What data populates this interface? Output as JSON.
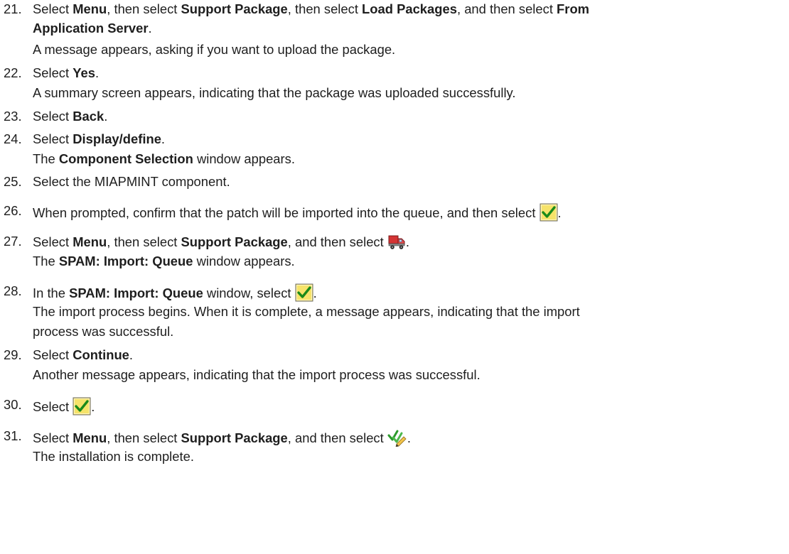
{
  "steps": [
    {
      "number": "21.",
      "lines": [
        [
          {
            "t": "Select "
          },
          {
            "t": "Menu",
            "b": true
          },
          {
            "t": ", then select "
          },
          {
            "t": "Support Package",
            "b": true
          },
          {
            "t": ", then select "
          },
          {
            "t": "Load Packages",
            "b": true
          },
          {
            "t": ", and then select "
          },
          {
            "t": "From",
            "b": true
          }
        ],
        [
          {
            "t": "Application Server",
            "b": true
          },
          {
            "t": "."
          }
        ],
        [
          {
            "t": "A message appears, asking if you want to upload the package."
          }
        ]
      ]
    },
    {
      "number": "22.",
      "lines": [
        [
          {
            "t": "Select "
          },
          {
            "t": "Yes",
            "b": true
          },
          {
            "t": "."
          }
        ],
        [
          {
            "t": "A summary screen appears, indicating that the package was uploaded successfully."
          }
        ]
      ]
    },
    {
      "number": "23.",
      "lines": [
        [
          {
            "t": "Select "
          },
          {
            "t": "Back",
            "b": true
          },
          {
            "t": "."
          }
        ]
      ]
    },
    {
      "number": "24.",
      "lines": [
        [
          {
            "t": "Select "
          },
          {
            "t": "Display/define",
            "b": true
          },
          {
            "t": "."
          }
        ],
        [
          {
            "t": "The "
          },
          {
            "t": "Component Selection",
            "b": true
          },
          {
            "t": " window appears."
          }
        ]
      ]
    },
    {
      "number": "25.",
      "lines": [
        [
          {
            "t": "Select the MIAPMINT component."
          }
        ]
      ]
    },
    {
      "number": "26.",
      "lines": [
        [
          {
            "t": "When prompted, confirm that the patch will be imported into the queue, and then select "
          },
          {
            "icon": "checkmark-icon"
          },
          {
            "t": "."
          }
        ]
      ]
    },
    {
      "number": "27.",
      "lines": [
        [
          {
            "t": "Select "
          },
          {
            "t": "Menu",
            "b": true
          },
          {
            "t": ", then select "
          },
          {
            "t": "Support Package",
            "b": true
          },
          {
            "t": ", and then select "
          },
          {
            "icon": "truck-icon"
          },
          {
            "t": "."
          }
        ],
        [
          {
            "t": "The "
          },
          {
            "t": "SPAM: Import: Queue",
            "b": true
          },
          {
            "t": " window appears."
          }
        ]
      ]
    },
    {
      "number": "28.",
      "lines": [
        [
          {
            "t": "In the "
          },
          {
            "t": "SPAM: Import: Queue",
            "b": true
          },
          {
            "t": " window, select "
          },
          {
            "icon": "checkmark-icon"
          },
          {
            "t": "."
          }
        ],
        [
          {
            "t": "The import process begins. When it is complete, a message appears, indicating that the import"
          }
        ],
        [
          {
            "t": "process was successful."
          }
        ]
      ]
    },
    {
      "number": "29.",
      "lines": [
        [
          {
            "t": "Select "
          },
          {
            "t": "Continue",
            "b": true
          },
          {
            "t": "."
          }
        ],
        [
          {
            "t": "Another message appears, indicating that the import process was successful."
          }
        ]
      ]
    },
    {
      "number": "30.",
      "lines": [
        [
          {
            "t": "Select "
          },
          {
            "icon": "checkmark-icon"
          },
          {
            "t": "."
          }
        ]
      ]
    },
    {
      "number": "31.",
      "lines": [
        [
          {
            "t": "Select "
          },
          {
            "t": "Menu",
            "b": true
          },
          {
            "t": ", then select "
          },
          {
            "t": "Support Package",
            "b": true
          },
          {
            "t": ", and then select "
          },
          {
            "icon": "confirm-queue-icon"
          },
          {
            "t": "."
          }
        ],
        [
          {
            "t": "The installation is complete."
          }
        ]
      ]
    }
  ]
}
